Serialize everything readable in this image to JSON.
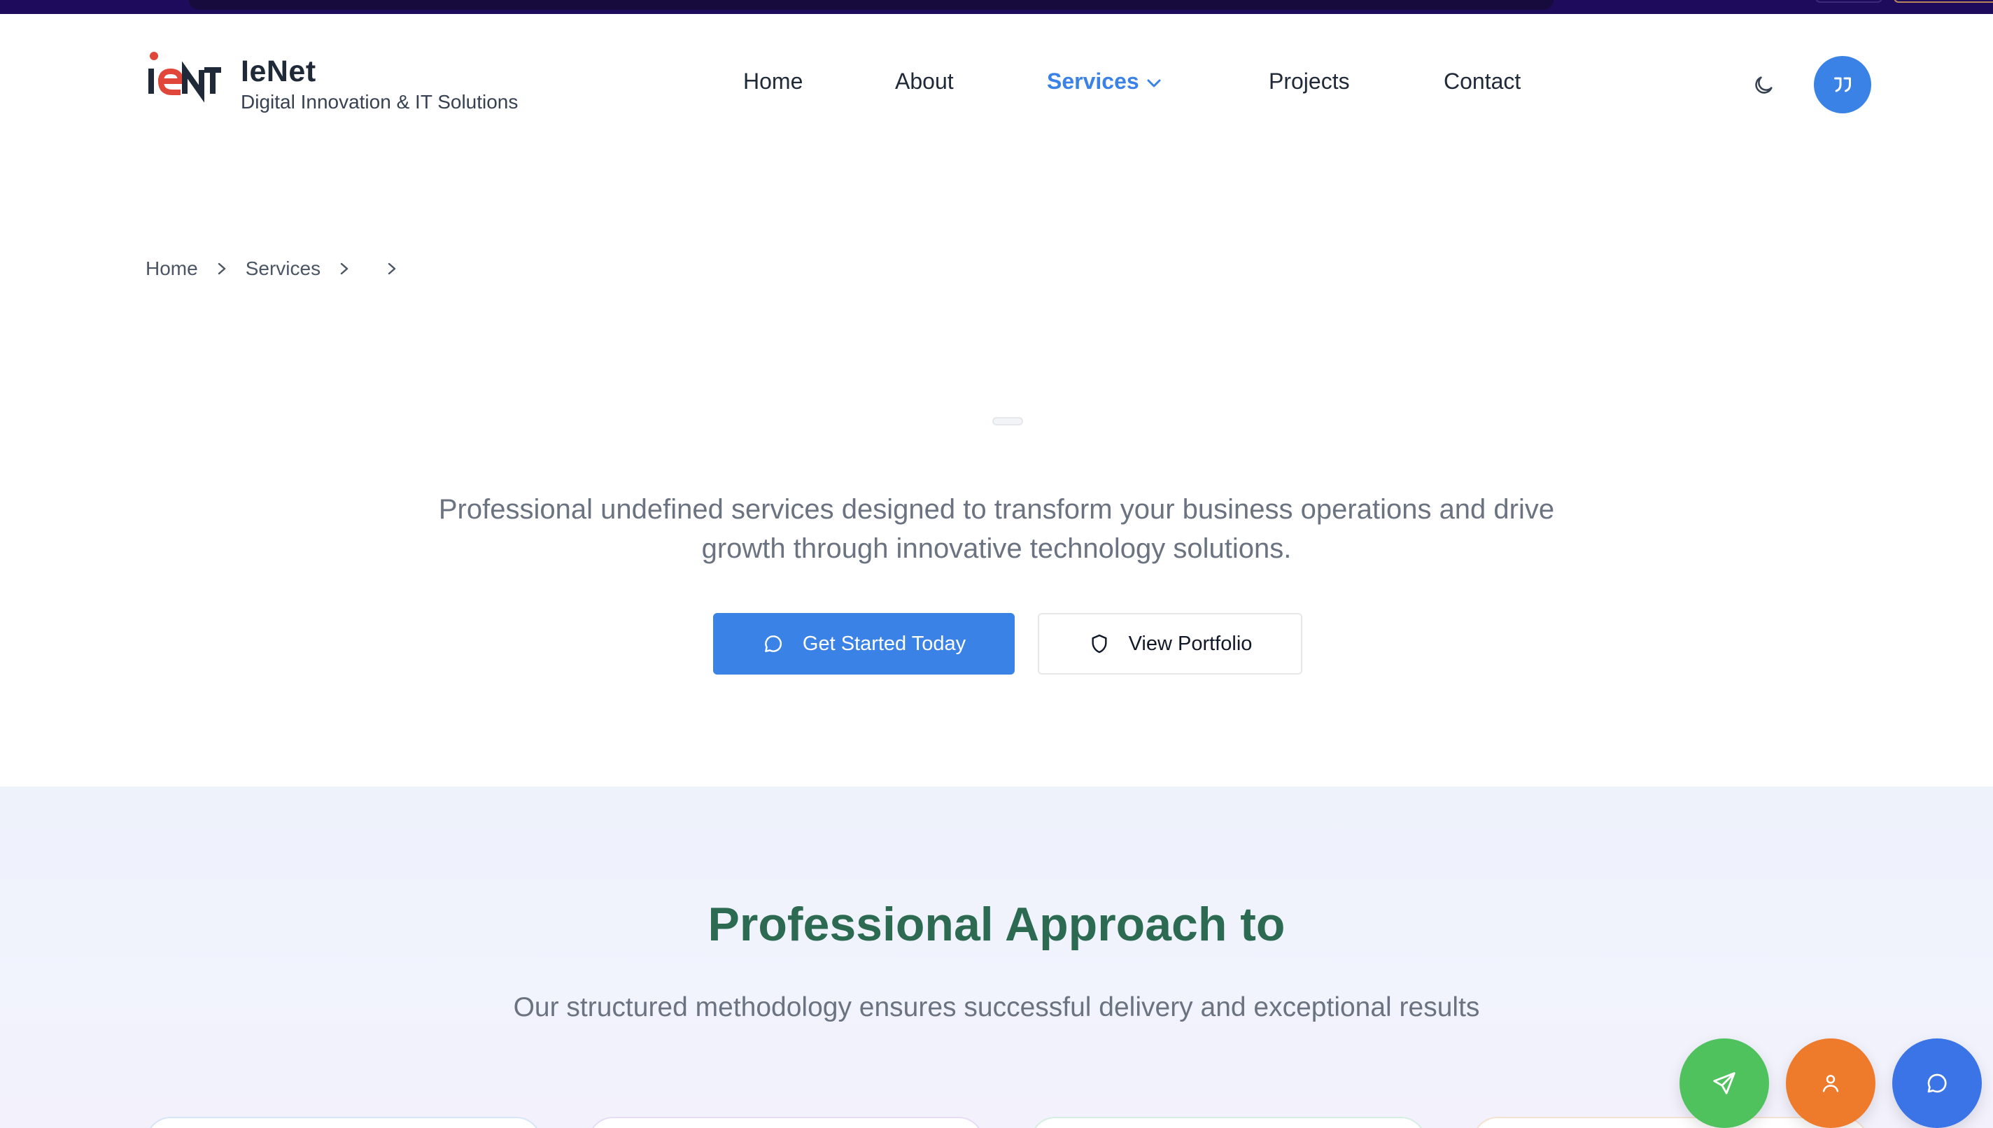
{
  "brand": {
    "name": "IeNet",
    "tagline": "Digital Innovation & IT Solutions",
    "colors": {
      "accent": "#3b82e6",
      "logo_red": "#e0463a",
      "logo_dark": "#1f2937"
    }
  },
  "nav": {
    "items": [
      {
        "label": "Home"
      },
      {
        "label": "About"
      },
      {
        "label": "Services",
        "active": true
      },
      {
        "label": "Projects"
      },
      {
        "label": "Contact"
      }
    ],
    "theme_toggle_icon": "moon-icon",
    "user_button_icon": "quote-icon"
  },
  "breadcrumb": {
    "items": [
      "Home",
      "Services",
      ""
    ]
  },
  "hero": {
    "description": "Professional undefined services designed to transform your business operations and drive growth through innovative technology solutions.",
    "primary_button": {
      "label": "Get Started Today",
      "icon": "chat-bubble-icon"
    },
    "secondary_button": {
      "label": "View Portfolio",
      "icon": "shield-icon"
    }
  },
  "approach": {
    "title": "Professional Approach to",
    "subtitle": "Our structured methodology ensures successful delivery and exceptional results",
    "title_color": "#2c6a52"
  },
  "floating_actions": [
    {
      "icon": "send-icon",
      "color": "#4fc25d"
    },
    {
      "icon": "user-icon",
      "color": "#ee7a2b"
    },
    {
      "icon": "chat-bubble-icon",
      "color": "#3b74e6"
    }
  ]
}
